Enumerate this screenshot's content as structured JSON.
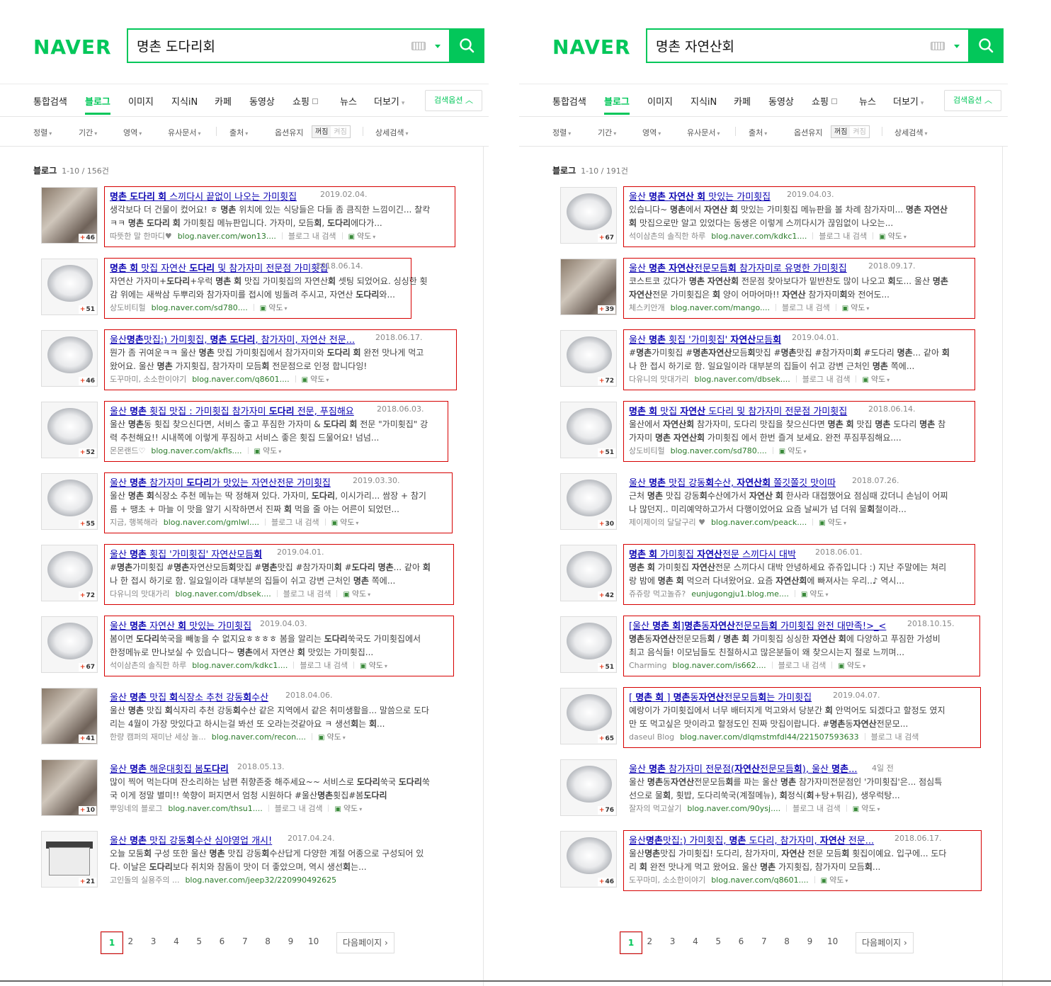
{
  "brand": "NAVER",
  "colors": {
    "accent": "#03c75a",
    "highlight_box": "#d60000",
    "link": "#0d05b3"
  },
  "icons": {
    "search": "search-icon",
    "keyboard": "keyboard-icon",
    "dropdown": "chevron-down-icon"
  },
  "nav": [
    "통합검색",
    "블로그",
    "이미지",
    "지식iN",
    "카페",
    "동영상",
    "쇼핑",
    "뉴스",
    "더보기"
  ],
  "nav_active": "블로그",
  "option_button": "검색옵션",
  "filters": {
    "sort": "정렬",
    "period": "기간",
    "area": "영역",
    "similar": "유사문서",
    "source": "출처",
    "keep": "옵션유지",
    "off": "꺼짐",
    "on": "켜짐",
    "detail": "상세검색"
  },
  "section_label": "블로그",
  "pagination": {
    "pages": [
      "1",
      "2",
      "3",
      "4",
      "5",
      "6",
      "7",
      "8",
      "9",
      "10"
    ],
    "next": "다음페이지",
    "current": "1"
  },
  "panels": [
    {
      "query": "명촌 도다리회",
      "count": "1-10 / 156건",
      "results": [
        {
          "title": "명촌 도다리 회 스끼다시 끝없이 나오는 가미횟집",
          "date": "2019.02.04.",
          "line1": "생각보다 더 건물이 컸어요! ㅎ 명촌 위치에 있는 식당들은 다들 좀 큼직한 느낌이긴... 찰칵",
          "line2": "ㅋㅋ 명촌 도다리 회 가미횟집 메뉴판입니다. 가자미, 모듬회, 도다리에다가...",
          "author": "따뜻한 말 한마디♥",
          "url": "blog.naver.com/won13....",
          "inblog": "블로그 내 검색",
          "trans": "약도",
          "thumb_count": "46"
        },
        {
          "title": "명촌 회 맛집 자연산 도다리 및 참가자미 전문점 가미횟집",
          "date": "2018.06.14.",
          "line1": "자연산 가자미+도다리+우럭 명촌 회 맛집 가미횟집의 자연산회 셋팅 되었어요. 싱싱한 횟",
          "line2": "감 위에는 새싹삼 두뿌리와 참가자미를 접시에 빙돌려 주시고, 자연산 도다리와...",
          "author": "상도비티헐",
          "url": "blog.naver.com/sd780....",
          "inblog": "",
          "trans": "약도",
          "thumb_count": "51"
        },
        {
          "title": "울산명촌맛집:) 가미횟집, 명촌 도다리, 참가자미, 자연산 전문...",
          "date": "2018.06.17.",
          "line1": "뭔가 좀 귀여운ㅋㅋ 울산 명촌 맛집 가미횟집에서 참가자미와 도다리 회 완전 맛나게 먹고",
          "line2": "왔어요. 울산 명촌 가지횟집, 참가자미 모듬회 전문점으로 인정 합니다잉!",
          "author": "도꾸마미, 소소한이야기",
          "url": "blog.naver.com/q8601....",
          "inblog": "",
          "trans": "약도",
          "thumb_count": "46"
        },
        {
          "title": "울산 명촌 횟집 맛집 : 가미횟집 참가자미 도다리 전문, 푸짐해요",
          "date": "2018.06.03.",
          "line1": "울산 명촌동 횟집 찾으신다면, 서비스 좋고 푸짐한 가자미 & 도다리 회 전문 \"가미횟집\" 강",
          "line2": "력 추천해요!! 시내쪽에 이렇게 푸짐하고 서비스 좋은 횟집 드물어요! 넘넘...",
          "author": "몬몬랜드♡",
          "url": "blog.naver.com/akfls....",
          "inblog": "",
          "trans": "약도",
          "thumb_count": "52"
        },
        {
          "title": "울산 명촌 참가자미 도다리가 맛있는 자연산전문 가미횟집",
          "date": "2019.03.30.",
          "line1": "울산 명촌 회식장소 추천 메뉴는 딱 정해져 있다. 가자미, 도다리, 이시가리... 쌈장 + 참기",
          "line2": "름 + 땡초 + 마늘 이 맛을 알기 시작하면서 진짜 회 먹을 줄 아는 어른이 되었던...",
          "author": "지금, 행복해라",
          "url": "blog.naver.com/gmlwl....",
          "inblog": "블로그 내 검색",
          "trans": "약도",
          "thumb_count": "55"
        },
        {
          "title": "울산 명촌 횟집 '가미횟집' 자연산모듬회",
          "date": "2019.04.01.",
          "line1": "#명촌가미횟집 #명촌자연산모듬회맛집 #명촌맛집 #참가자미회 #도다리 명촌... 같아 회",
          "line2": "나 한 접시 하기로 함. 일요일이라 대부분의 집들이 쉬고 강변 근처인 명촌 쪽에...",
          "author": "다유니의 맛대가리",
          "url": "blog.naver.com/dbsek....",
          "inblog": "블로그 내 검색",
          "trans": "약도",
          "thumb_count": "72"
        },
        {
          "title": "울산 명촌 자연산 회 맛있는 가미횟집",
          "date": "2019.04.03.",
          "line1": "봄이면 도다리쑥국을 빼놓을 수 없지요ㅎㅎㅎㅎ 봄을 알리는 도다리쑥국도 가미횟집에서",
          "line2": "한정메뉴로 만나보실 수 있습니다~ 명촌에서 자연산 회 맛있는 가미횟집...",
          "author": "석이삼촌의 솔직한 하루",
          "url": "blog.naver.com/kdkc1....",
          "inblog": "블로그 내 검색",
          "trans": "약도",
          "thumb_count": "67"
        },
        {
          "title": "울산 명촌 맛집 회식장소 추천 강동회수산",
          "date": "2018.04.06.",
          "line1": "울산 명촌 맛집 회식자리 추천 강동회수산 같은 지역에서 같은 취미생활을... 말씀으로 도다",
          "line2": "리는 4월이 가장 맛있다고 하시는걸 봐선 또 오라는것같아요 ㅋ 생선회는 회...",
          "author": "한량 캠퍼의 재미난 세상 놀...",
          "url": "blog.naver.com/recon....",
          "inblog": "",
          "trans": "약도",
          "thumb_count": "41"
        },
        {
          "title": "울산 명촌 해운대횟집 봄도다리",
          "date": "2018.05.13.",
          "line1": "많이 찍어 먹는다며 잔소리하는 남편 취향존중 해주세요~~ 서비스로 도다리쑥국 도다리쑥",
          "line2": "국 이게 정말 별미!! 쑥향이 퍼지면서 엄청 시원하다 #울산명촌횟집#봄도다리",
          "author": "뿌잉네의 블로그",
          "url": "blog.naver.com/thsu1....",
          "inblog": "블로그 내 검색",
          "trans": "약도",
          "thumb_count": "10"
        },
        {
          "title": "울산 명촌 맛집 강동회수산 심야영업 개시!",
          "date": "2017.04.24.",
          "line1": "오늘 모둠회 구성 또한 울산 명촌 맛집 강동회수산답게 다양한 계절 어종으로 구성되어 있",
          "line2": "다. 이날은 도다리보다 쥐치와 참돔이 맛이 더 좋았으며, 역시 생선회는...",
          "author": "고인돌의 실용주의 ...",
          "url": "blog.naver.com/jeep32/220990492625",
          "inblog": "",
          "trans": "",
          "thumb_count": "21"
        }
      ]
    },
    {
      "query": "명촌 자연산회",
      "count": "1-10 / 191건",
      "results": [
        {
          "title": "울산 명촌 자연산 회 맛있는 가미횟집",
          "date": "2019.04.03.",
          "line1": "있습니다~ 명촌에서 자연산 회 맛있는 가미횟집 메뉴판을 볼 차례 참가자미... 명촌 자연산",
          "line2": "회 맛집으로만 알고 있었다는 동생은 이렇게 스끼다시가 끊임없이 나오는...",
          "author": "석이삼촌의 솔직한 하루",
          "url": "blog.naver.com/kdkc1....",
          "inblog": "블로그 내 검색",
          "trans": "약도",
          "thumb_count": "67"
        },
        {
          "title": "울산 명촌 자연산전문모듬회 참가자미로 유명한 가미횟집",
          "date": "2018.09.17.",
          "line1": "코스트코 갔다가 명촌 자연산회 전문점 찾아보다가 밑반찬도 많이 나오고 회도... 울산 명촌",
          "line2": "자연산전문 가미횟집은 회 양이 어마어마!! 자연산 참가자미회와 전어도...",
          "author": "체스키안개",
          "url": "blog.naver.com/mango....",
          "inblog": "블로그 내 검색",
          "trans": "약도",
          "thumb_count": "39"
        },
        {
          "title": "울산 명촌 횟집 '가미횟집' 자연산모듬회",
          "date": "2019.04.01.",
          "line1": "#명촌가미횟집 #명촌자연산모듬회맛집 #명촌맛집 #참가자미회 #도다리 명촌... 같아 회",
          "line2": "나 한 접시 하기로 함. 일요일이라 대부분의 집들이 쉬고 강변 근처인 명촌 쪽에...",
          "author": "다유니의 맛대가리",
          "url": "blog.naver.com/dbsek....",
          "inblog": "블로그 내 검색",
          "trans": "약도",
          "thumb_count": "72"
        },
        {
          "title": "명촌 회 맛집 자연산 도다리 및 참가자미 전문점 가미횟집",
          "date": "2018.06.14.",
          "line1": "울산에서 자연산회 참가자미, 도다리 맛집을 찾으신다면 명촌 회 맛집 명촌 도다리 명촌 참",
          "line2": "가자미 명촌 자연산회 가미횟집 에서 한번 즐겨 보세요. 완전 푸짐푸짐해요....",
          "author": "상도비티헐",
          "url": "blog.naver.com/sd780....",
          "inblog": "",
          "trans": "약도",
          "thumb_count": "51"
        },
        {
          "title": "울산 명촌 맛집 강동회수산, 자연산회 쫄깃쫄깃 맛이따",
          "date": "2018.07.26.",
          "line1": "근처 명촌 맛집 강동회수산에가서 자연산 회 한사라 대접했어요 점심때 갔더니 손님이 어찌",
          "line2": "나 많던지.. 미리예약하고가서 다행이었어요 요즘 날씨가 넘 더워 물회철이라...",
          "author": "제이제이의 달달구리 ♥",
          "url": "blog.naver.com/peack....",
          "inblog": "",
          "trans": "약도",
          "thumb_count": "30"
        },
        {
          "title": "명촌 회 가미횟집 자연산전문 스끼다시 대박",
          "date": "2018.06.01.",
          "line1": "명촌 회 가미횟집 자연산전문 스끼다시 대박 안녕하세요 쥬쥬입니다 :) 지난 주말에는 쳐리",
          "line2": "랑 밤에 명촌 회 먹으러 다녀왔어요. 요즘 자연산회에 빠져사는 우리..♪ 역시...",
          "author": "쥬쥬랑 먹고놀쥬?",
          "url": "eunjugongju1.blog.me....",
          "inblog": "",
          "trans": "약도",
          "thumb_count": "42"
        },
        {
          "title": "[울산 명촌 회]명촌동자연산전문모듬회 가미횟집 완전 대만족!>_<",
          "date": "2018.10.15.",
          "line1": "명촌동자연산전문모듬회 / 명촌 회 가미횟집 싱싱한 자연산 회에 다양하고 푸짐한 가성비",
          "line2": "최고 음식들! 이모님들도 친절하시고 많은분들이 왜 찾으시는지 절로 느끼며...",
          "author": "Charming",
          "url": "blog.naver.com/is662....",
          "inblog": "블로그 내 검색",
          "trans": "약도",
          "thumb_count": "51"
        },
        {
          "title": "[ 명촌 회 ] 명촌동자연산전문모듬회는 가미횟집",
          "date": "2019.04.07.",
          "line1": "예랑이가 가미횟집에서 너무 배터지게 먹고와서 당분간 회 안먹어도 되겠다고 할정도 였지",
          "line2": "만 또 먹고싶은 맛이라고 할정도인 진짜 맛집이랍니다. #명촌동자연산전문모...",
          "author": "daseul Blog",
          "url": "blog.naver.com/dlqmstmfdl44/221507593633",
          "inblog": "블로그 내 검색",
          "trans": "",
          "thumb_count": "65"
        },
        {
          "title": "울산 명촌 참가자미 전문점(자연산전문모듬회), 울산 명촌...",
          "date": "4일 전",
          "line1": "울산 명촌동자연산전문모듬회를 파는 울산 명촌 참가자미전문점인 '가미횟집'은... 점심특",
          "line2": "선으로 물회, 횟밥, 도다리쑥국(계절메뉴), 회정식(회+탕+튀김), 생우럭탕...",
          "author": "잘자의 먹고살기",
          "url": "blog.naver.com/90ysj....",
          "inblog": "블로그 내 검색",
          "trans": "약도",
          "thumb_count": "76"
        },
        {
          "title": "울산명촌맛집:) 가미횟집, 명촌 도다리, 참가자미, 자연산 전문...",
          "date": "2018.06.17.",
          "line1": "울산명촌맛집 가미횟집! 도다리, 참가자미, 자연산 전문 모듬회 횟집이예요. 입구에... 도다",
          "line2": "리 회 완전 맛나게 먹고 왔어요. 울산 명촌 가지횟집, 참가자미 모듬회...",
          "author": "도꾸마미, 소소한이야기",
          "url": "blog.naver.com/q8601....",
          "inblog": "",
          "trans": "약도",
          "thumb_count": "46"
        }
      ]
    }
  ]
}
